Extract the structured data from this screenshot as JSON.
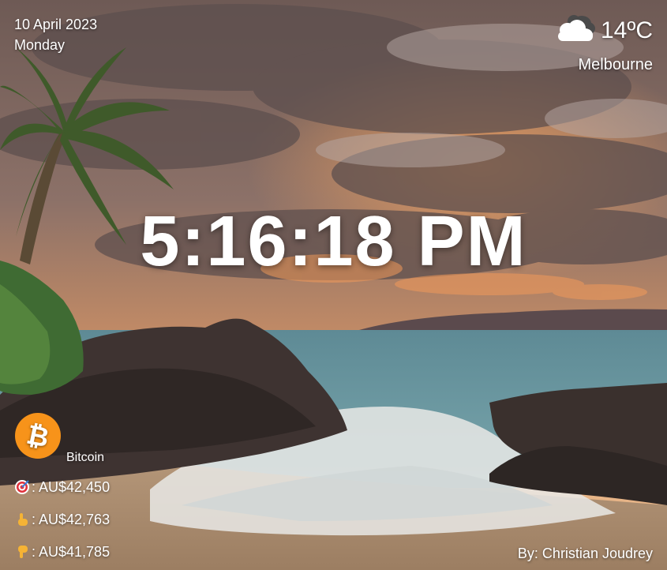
{
  "date": {
    "full": "10 April 2023",
    "weekday": "Monday"
  },
  "weather": {
    "icon": "cloudy-icon",
    "temperature": "14ºC",
    "city": "Melbourne"
  },
  "clock": {
    "time": "5:16:18 PM"
  },
  "crypto": {
    "icon": "bitcoin-icon",
    "name": "Bitcoin",
    "accent": "#f7931a",
    "prices": [
      {
        "icon": "target-icon",
        "text": ": AU$42,450"
      },
      {
        "icon": "pointing-up-icon",
        "text": ": AU$42,763"
      },
      {
        "icon": "pointing-down-icon",
        "text": ": AU$41,785"
      }
    ]
  },
  "credit": {
    "text": "By: Christian Joudrey"
  }
}
